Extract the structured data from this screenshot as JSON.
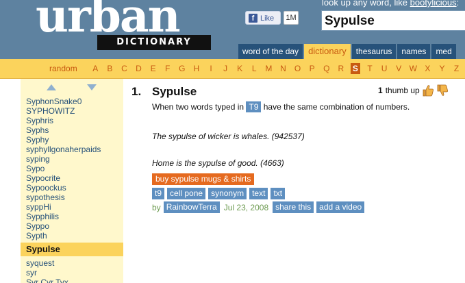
{
  "header": {
    "logo_word": "urban",
    "logo_tag": "DICTIONARY",
    "lookup_prefix": "look up any word, like ",
    "lookup_example": "bootylicious",
    "lookup_suffix": ":",
    "search_value": "Sypulse",
    "fb_like_label": "Like",
    "fb_like_count": "1M",
    "tabs": [
      {
        "label": "word of the day",
        "active": false
      },
      {
        "label": "dictionary",
        "active": true
      },
      {
        "label": "thesaurus",
        "active": false
      },
      {
        "label": "names",
        "active": false
      },
      {
        "label": "med",
        "active": false
      }
    ]
  },
  "alphabet": {
    "random_label": "random",
    "letters": [
      "A",
      "B",
      "C",
      "D",
      "E",
      "F",
      "G",
      "H",
      "I",
      "J",
      "K",
      "L",
      "M",
      "N",
      "O",
      "P",
      "Q",
      "R",
      "S",
      "T",
      "U",
      "V",
      "W",
      "X",
      "Y",
      "Z"
    ],
    "current": "S"
  },
  "sidebar": {
    "items": [
      "SyphonSnake0",
      "SYPHOWITZ",
      "Syphris",
      "Syphs",
      "Syphy",
      "syphyllgonaherpaids",
      "syping",
      "Sypo",
      "Sypocrite",
      "Sypoockus",
      "sypothesis",
      "syppHi",
      "Sypphilis",
      "Syppo",
      "Sypth",
      "Sypulse",
      "syquest",
      "syr",
      "Syr Cyr Tyx"
    ],
    "current": "Sypulse"
  },
  "entry": {
    "number": "1.",
    "word": "Sypulse",
    "thumbs_count": "1",
    "thumbs_label": "thumb up",
    "definition_before": "When two words typed in ",
    "definition_tag": "T9",
    "definition_after": " have the same combination of numbers.",
    "example_1": "The sypulse of wicker is whales. (942537)",
    "example_2": "Home is the sypulse of good. (4663)",
    "buy_label": "buy sypulse mugs & shirts",
    "tags": [
      "t9",
      "cell pone",
      "synonym",
      "text",
      "txt"
    ],
    "by_label": "by",
    "author": "RainbowTerra",
    "date": "Jul 23, 2008",
    "share_label": "share this",
    "add_video_label": "add a video"
  },
  "colors": {
    "header_bg": "#5e82a0",
    "tab_bg": "#27527a",
    "accent_yellow": "#fbd35c",
    "accent_orange": "#c85a10",
    "sidebar_bg": "#fff8cc",
    "tag_blue": "#5e8fc0",
    "buy_orange": "#e56a1f"
  }
}
